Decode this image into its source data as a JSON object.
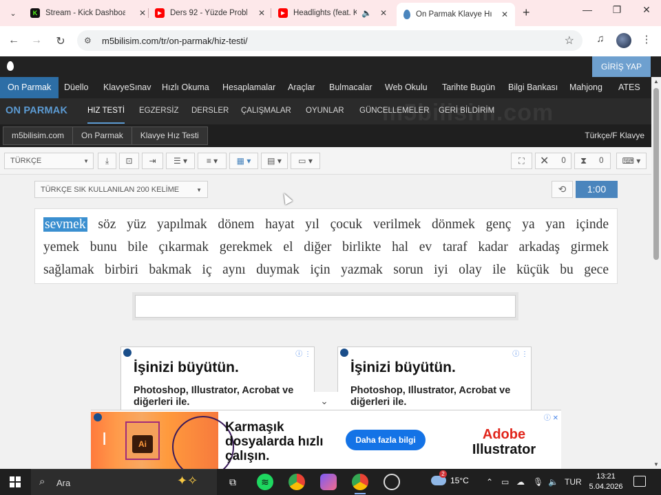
{
  "browser": {
    "tabs": [
      {
        "title": "Stream - Kick Dashboa",
        "favicon_color": "#53fc18",
        "favicon_glyph": "K",
        "active": false
      },
      {
        "title": "Ders 92 - Yüzde Proble",
        "favicon_color": "#ff0000",
        "favicon_glyph": "▶",
        "active": false
      },
      {
        "title": "Headlights (feat. K",
        "favicon_color": "#ff0000",
        "favicon_glyph": "▶",
        "active": false
      },
      {
        "title": "On Parmak Klavye Hız",
        "favicon_color": "#4a85bd",
        "favicon_glyph": "",
        "active": true
      }
    ],
    "url": "m5bilisim.com/tr/on-parmak/hiz-testi/"
  },
  "site": {
    "login_label": "GİRİŞ YAP",
    "main_nav": [
      "On Parmak",
      "Düello",
      "KlavyeSınav",
      "Hızlı Okuma",
      "Hesaplamalar",
      "Araçlar",
      "Bulmacalar",
      "Web Okulu",
      "Tarihte Bugün",
      "Bilgi Bankası",
      "Mahjong",
      "ATES"
    ],
    "sub_brand": "ON PARMAK",
    "sub_nav": [
      "HIZ TESTİ",
      "EGZERSİZ",
      "DERSLER",
      "ÇALIŞMALAR",
      "OYUNLAR",
      "GÜNCELLEMELER",
      "GERİ BİLDİRİM"
    ],
    "watermark": "m5bilisim.com",
    "breadcrumbs": [
      "m5bilisim.com",
      "On Parmak",
      "Klavye Hız Testi"
    ],
    "keyboard_layout": "Türkçe/F Klavye"
  },
  "tools": {
    "language": "TÜRKÇE",
    "error_count": "0",
    "time_count": "0"
  },
  "test": {
    "word_set": "TÜRKÇE SIK KULLANILAN 200 KELİME",
    "timer": "1:00",
    "current_word": "sevmek",
    "line1_rest": "söz yüz yapılmak dönem hayat yıl çocuk verilmek dönmek genç ya yan içinde",
    "line2": "yemek bunu bile çıkarmak gerekmek el diğer birlikte hal ev taraf kadar arkadaş girmek",
    "line3": "sağlamak birbiri bakmak iç aynı duymak için yazmak sorun iyi olay ile küçük bu gece"
  },
  "ads": {
    "card_headline": "İşinizi büyütün.",
    "card_body": "Photoshop, Illustrator, Acrobat ve diğerleri ile.",
    "banner_headline": "Karmaşık dosyalarda hızlı çalışın.",
    "banner_cta": "Daha fazla bilgi",
    "banner_brand_top": "Adobe",
    "banner_brand_bottom": "Illustrator",
    "banner_ai_glyph": "Ai"
  },
  "taskbar": {
    "search_placeholder": "Ara",
    "weather_temp": "15°C",
    "weather_badge": "2",
    "language": "TUR",
    "time": "13:21",
    "date": "5.04.2026"
  }
}
